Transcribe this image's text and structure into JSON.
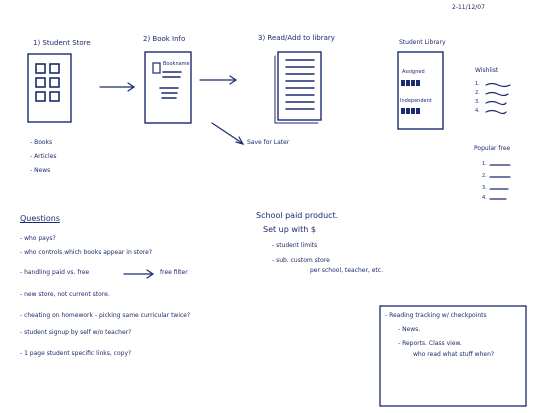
{
  "date": "2-11/12/07",
  "screens": {
    "s1": {
      "title": "1) Student Store",
      "items": [
        "- Books",
        "- Articles",
        "- News"
      ]
    },
    "s2": {
      "title": "2) Book Info",
      "inner_label": "Bookname"
    },
    "s3": {
      "title": "3) Read/Add to library",
      "save_later": "Save for Later"
    },
    "library": {
      "title": "Student Library",
      "assigned": "Assigned",
      "independent": "Independent"
    },
    "wishlist": {
      "title": "Wishlist",
      "items": [
        "1.",
        "2.",
        "3.",
        "4."
      ]
    },
    "popular": {
      "title": "Popular free",
      "items": [
        "1.",
        "2.",
        "3.",
        "4."
      ]
    }
  },
  "questions": {
    "heading": "Questions",
    "items": [
      "- who pays?",
      "- who controls which books appear in store?",
      "- handling paid vs. free",
      "- new store, not current store.",
      "- cheating on homework - picking same curricular twice?",
      "- student signup by self w/o teacher?",
      "- 1 page student specific links, copy?"
    ],
    "free_filter": "free filter"
  },
  "school": {
    "line1": "School paid product.",
    "line2": "Set up with $",
    "items": [
      "- student limits",
      "- sub. custom store"
    ],
    "sub_note": "per school, teacher, etc."
  },
  "tracking": {
    "title": "- Reading tracking w/ checkpoints",
    "items": [
      "- News.",
      "- Reports. Class view."
    ],
    "note": "who read what stuff when?"
  }
}
